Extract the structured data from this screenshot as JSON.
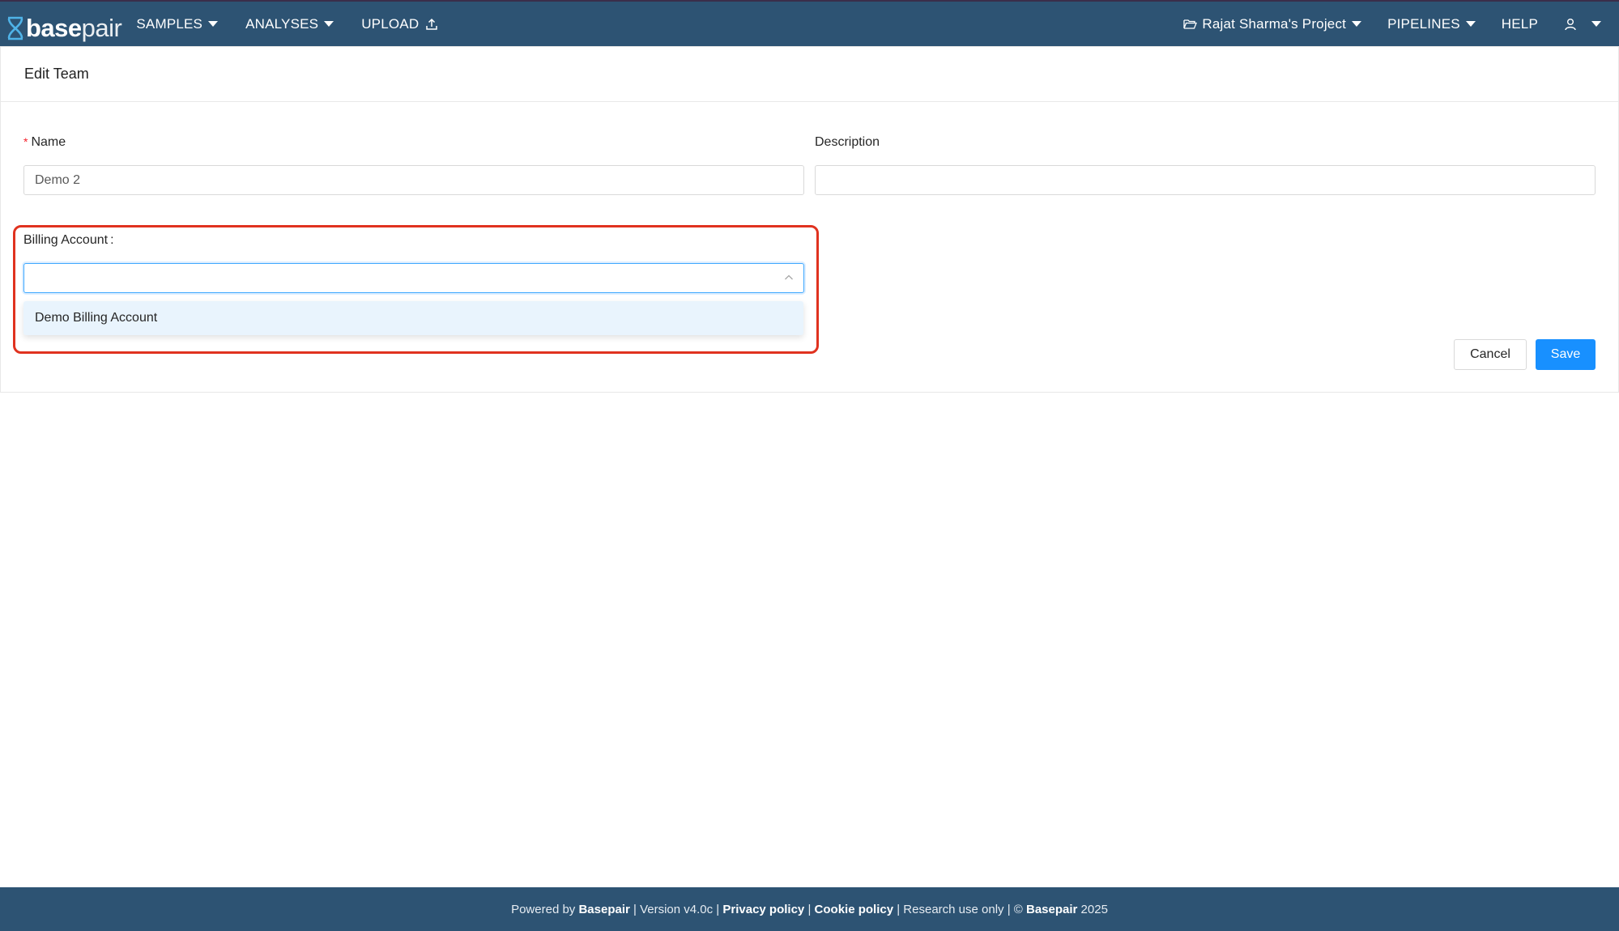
{
  "navbar": {
    "logo_bold": "base",
    "logo_light": "pair",
    "samples": "SAMPLES",
    "analyses": "ANALYSES",
    "upload": "UPLOAD",
    "project": "Rajat Sharma's Project",
    "pipelines": "PIPELINES",
    "help": "HELP",
    "background_color": "#2d5373"
  },
  "card": {
    "title": "Edit Team"
  },
  "form": {
    "name_label": "Name",
    "name_required_mark": "*",
    "name_value": "Demo 2",
    "description_label": "Description",
    "description_value": "",
    "billing_label": "Billing Account",
    "billing_colon": ":",
    "billing_value": "",
    "billing_options": [
      "Demo Billing Account"
    ]
  },
  "actions": {
    "cancel": "Cancel",
    "save": "Save",
    "primary_color": "#1890ff"
  },
  "footer": {
    "powered_by": "Powered by",
    "brand": "Basepair",
    "version": "| Version v4.0c |",
    "privacy": "Privacy policy",
    "sep1": "|",
    "cookie": "Cookie policy",
    "research": "| Research use only | ©",
    "brand2": "Basepair",
    "year": "2025"
  },
  "highlight_color": "#e0321f"
}
